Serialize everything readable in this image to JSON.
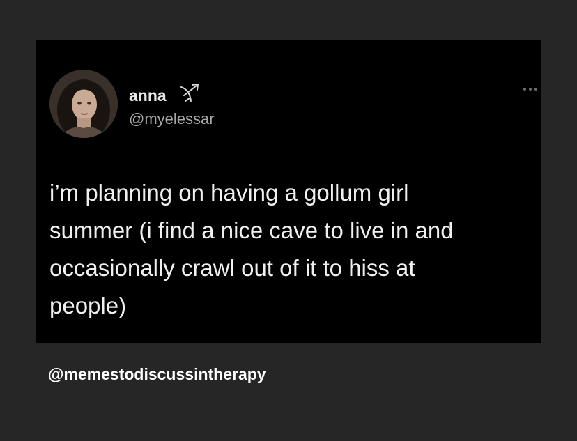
{
  "tweet": {
    "display_name": "anna",
    "handle": "@myelessar",
    "badge_icon": "sagittarius-icon",
    "more_icon": "more-options-icon",
    "text_lines": [
      "i’m planning on having a gollum girl",
      "summer (i find a nice cave to live in and",
      "occasionally crawl out of it to hiss at",
      "people)"
    ]
  },
  "watermark": "@memestodiscussintherapy",
  "colors": {
    "page_background": "#262626",
    "card_background": "#000000",
    "text_primary": "#f0f0f0",
    "text_secondary": "#a9a9a9"
  }
}
